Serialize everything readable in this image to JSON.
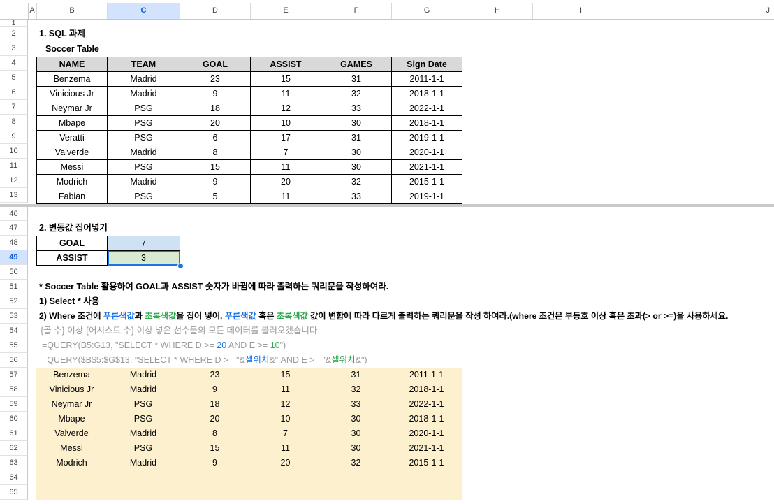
{
  "columns": [
    "A",
    "B",
    "C",
    "D",
    "E",
    "F",
    "G",
    "H",
    "I",
    "J"
  ],
  "selected_column": "C",
  "rows_top": [
    "1",
    "2",
    "3",
    "4",
    "5",
    "6",
    "7",
    "8",
    "9",
    "10",
    "11",
    "12",
    "13"
  ],
  "rows_bottom": [
    "46",
    "47",
    "48",
    "49",
    "50",
    "51",
    "52",
    "53",
    "54",
    "55",
    "56",
    "57",
    "58",
    "59",
    "60",
    "61",
    "62",
    "63",
    "64",
    "65"
  ],
  "selected_row": "49",
  "section1": {
    "title": "1. SQL 과제",
    "subtitle": "Soccer Table",
    "headers": [
      "NAME",
      "TEAM",
      "GOAL",
      "ASSIST",
      "GAMES",
      "Sign Date"
    ],
    "rows": [
      [
        "Benzema",
        "Madrid",
        "23",
        "15",
        "31",
        "2011-1-1"
      ],
      [
        "Vinicious Jr",
        "Madrid",
        "9",
        "11",
        "32",
        "2018-1-1"
      ],
      [
        "Neymar Jr",
        "PSG",
        "18",
        "12",
        "33",
        "2022-1-1"
      ],
      [
        "Mbape",
        "PSG",
        "20",
        "10",
        "30",
        "2018-1-1"
      ],
      [
        "Veratti",
        "PSG",
        "6",
        "17",
        "31",
        "2019-1-1"
      ],
      [
        "Valverde",
        "Madrid",
        "8",
        "7",
        "30",
        "2020-1-1"
      ],
      [
        "Messi",
        "PSG",
        "15",
        "11",
        "30",
        "2021-1-1"
      ],
      [
        "Modrich",
        "Madrid",
        "9",
        "20",
        "32",
        "2015-1-1"
      ],
      [
        "Fabian",
        "PSG",
        "5",
        "11",
        "33",
        "2019-1-1"
      ]
    ]
  },
  "section2": {
    "title": "2. 변동값 집어넣기",
    "goal_label": "GOAL",
    "goal_value": "7",
    "assist_label": "ASSIST",
    "assist_value": "3",
    "instruction": "* Soccer Table 활용하여 GOAL과 ASSIST 숫자가 바뀜에 따라 출력하는 쿼리문을 작성하여라.",
    "step1": "1) Select * 사용",
    "step2": {
      "p1": "2) Where 조건에 ",
      "blue1": "푸른색값",
      "p2": "과 ",
      "green1": "초록색값",
      "p3": "을 집어 넣어, ",
      "blue2": "푸른색값",
      "p4": " 혹은 ",
      "green2": "초록색값",
      "p5": " 값이 변함에 따라 다르게 출력하는 쿼리문을 작성 하여라.(where 조건은 부등호 이상 혹은 초과(> or >=)을 사용하세요."
    },
    "hint": "{골 수} 이상 {어시스트 수} 이상 넣은 선수들의 모든 데이터를 불러오겠습니다.",
    "query1": {
      "p1": "=QUERY(B5:G13, \"SELECT * WHERE D >= ",
      "n1": "20",
      "p2": " AND E >= ",
      "n2": "10",
      "p3": "\")"
    },
    "query2": {
      "p1": "=QUERY($B$5:$G$13, \"SELECT * WHERE D >= \"&",
      "ref1": "셀위치",
      "p2": "&\" AND E >= \"&",
      "ref2": "셀위치",
      "p3": "&\")"
    },
    "results": [
      [
        "Benzema",
        "Madrid",
        "23",
        "15",
        "31",
        "2011-1-1"
      ],
      [
        "Vinicious Jr",
        "Madrid",
        "9",
        "11",
        "32",
        "2018-1-1"
      ],
      [
        "Neymar Jr",
        "PSG",
        "18",
        "12",
        "33",
        "2022-1-1"
      ],
      [
        "Mbape",
        "PSG",
        "20",
        "10",
        "30",
        "2018-1-1"
      ],
      [
        "Valverde",
        "Madrid",
        "8",
        "7",
        "30",
        "2020-1-1"
      ],
      [
        "Messi",
        "PSG",
        "15",
        "11",
        "30",
        "2021-1-1"
      ],
      [
        "Modrich",
        "Madrid",
        "9",
        "20",
        "32",
        "2015-1-1"
      ]
    ]
  },
  "colors": {
    "goal_cell": "#cfe2f3",
    "assist_cell": "#d9ead3",
    "result_bg": "#fdf0cf",
    "header_bg": "#d9d9d9",
    "selection": "#1a73e8"
  }
}
